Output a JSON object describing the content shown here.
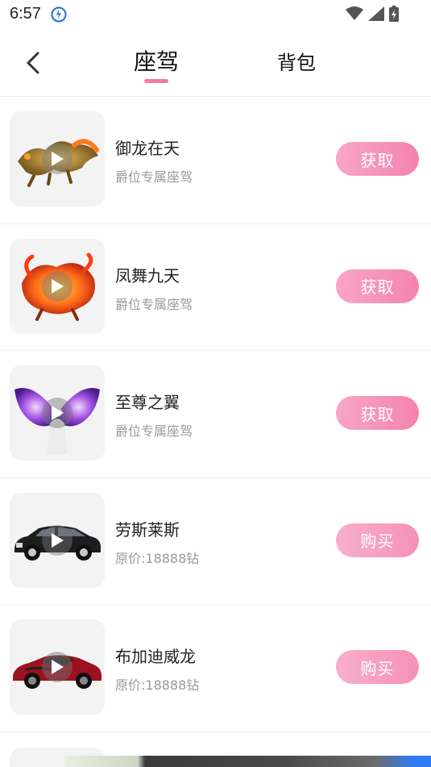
{
  "status_bar": {
    "time": "6:57",
    "icons": [
      "app-notification-icon",
      "wifi-icon",
      "cell-signal-icon",
      "battery-charging-icon"
    ]
  },
  "header": {
    "back_icon": "chevron-left-icon",
    "tabs": [
      {
        "label": "座驾",
        "active": true
      },
      {
        "label": "背包",
        "active": false
      }
    ],
    "accent_color": "#f27aa8"
  },
  "items": [
    {
      "title": "御龙在天",
      "subtitle": "爵位专属座驾",
      "action": "获取",
      "thumb": "golden-dragon"
    },
    {
      "title": "凤舞九天",
      "subtitle": "爵位专属座驾",
      "action": "获取",
      "thumb": "fire-phoenix"
    },
    {
      "title": "至尊之翼",
      "subtitle": "爵位专属座驾",
      "action": "获取",
      "thumb": "purple-wings"
    },
    {
      "title": "劳斯莱斯",
      "subtitle": "原价:18888钻",
      "action": "购买",
      "thumb": "black-sedan"
    },
    {
      "title": "布加迪威龙",
      "subtitle": "原价:18888钻",
      "action": "购买",
      "thumb": "red-sports-car"
    }
  ],
  "colors": {
    "button_gradient_start": "#f9a6c6",
    "button_gradient_end": "#f383b0",
    "subtitle": "#9a9a9a"
  }
}
